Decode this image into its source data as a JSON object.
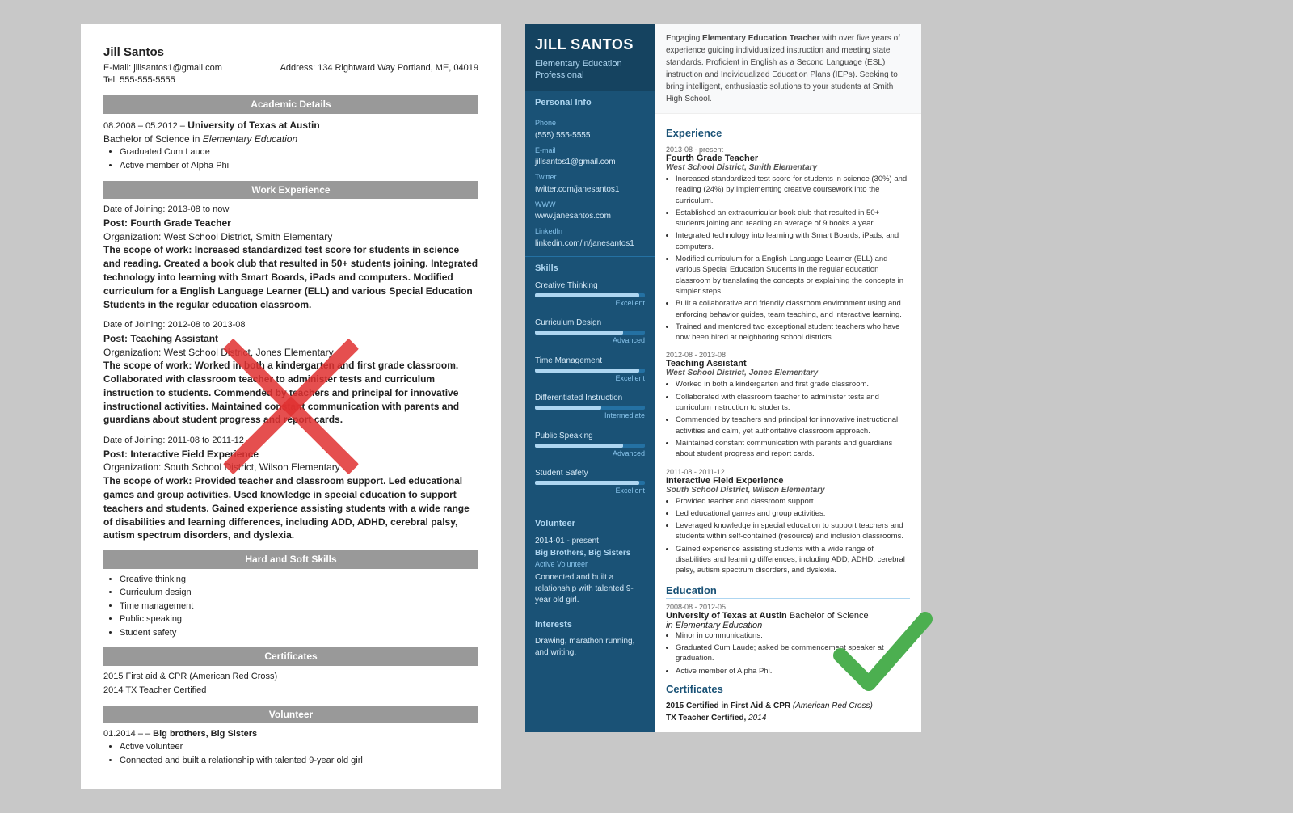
{
  "left": {
    "name": "Jill Santos",
    "email_label": "E-Mail:",
    "email": "jillsantos1@gmail.com",
    "address_label": "Address:",
    "address": "134 Rightward Way Portland, ME, 04019",
    "tel_label": "Tel:",
    "tel": "555-555-5555",
    "sections": {
      "academic": "Academic Details",
      "work": "Work Experience",
      "skills_title": "Hard and Soft Skills",
      "certs_title": "Certificates",
      "volunteer_title": "Volunteer"
    },
    "education": {
      "dates": "08.2008 – 05.2012 –",
      "school": "University of Texas at Austin",
      "degree": "Bachelor of Science in Elementary Education",
      "bullets": [
        "Graduated Cum Laude",
        "Active member of Alpha Phi"
      ]
    },
    "work": [
      {
        "dates": "Date of Joining: 2013-08 to now",
        "post_label": "Post:",
        "post": "Fourth Grade Teacher",
        "org_label": "Organization:",
        "org": "West School District, Smith Elementary",
        "scope_label": "The scope of work:",
        "scope": "Increased standardized test score for students in science and reading. Created a book club that resulted in 50+ students joining. Integrated technology into learning with Smart Boards, iPads and computers. Modified curriculum for a English Language Learner (ELL) and various Special Education Students in the regular education classroom."
      },
      {
        "dates": "Date of Joining: 2012-08 to 2013-08",
        "post_label": "Post:",
        "post": "Teaching Assistant",
        "org_label": "Organization:",
        "org": "West School District, Jones Elementary",
        "scope_label": "The scope of work:",
        "scope": "Worked in both a kindergarten and first grade classroom. Collaborated with classroom teacher to administer tests and curriculum instruction to students. Commended by teachers and principal for innovative instructional activities. Maintained constant communication with parents and guardians about student progress and report cards."
      },
      {
        "dates": "Date of Joining: 2011-08 to 2011-12",
        "post_label": "Post:",
        "post": "Interactive Field Experience",
        "org_label": "Organization:",
        "org": "South School District, Wilson Elementary",
        "scope_label": "The scope of work:",
        "scope": "Provided teacher and classroom support. Led educational games and group activities. Used knowledge in special education to support teachers and students. Gained experience assisting students with a wide range of disabilities and learning differences, including ADD, ADHD, cerebral palsy, autism spectrum disorders, and dyslexia."
      }
    ],
    "skills": [
      "Creative thinking",
      "Curriculum design",
      "Time management",
      "Public speaking",
      "Student safety"
    ],
    "certs": [
      "2015 First aid & CPR (American Red Cross)",
      "2014 TX Teacher Certified"
    ],
    "volunteer": {
      "dates": "01.2014 –",
      "org": "Big brothers, Big Sisters",
      "bullets": [
        "Active volunteer",
        "Connected and built a relationship with talented 9-year old girl"
      ]
    }
  },
  "right": {
    "name": "JILL SANTOS",
    "title": "Elementary Education Professional",
    "summary": "Engaging Elementary Education Teacher with over five years of experience guiding individualized instruction and meeting state standards. Proficient in English as a Second Language (ESL) instruction and Individualized Education Plans (IEPs). Seeking to bring intelligent, enthusiastic solutions to your students at Smith High School.",
    "sidebar": {
      "personal_info_title": "Personal Info",
      "phone_label": "Phone",
      "phone": "(555) 555-5555",
      "email_label": "E-mail",
      "email": "jillsantos1@gmail.com",
      "twitter_label": "Twitter",
      "twitter": "twitter.com/janesantos1",
      "www_label": "WWW",
      "www": "www.janesantos.com",
      "linkedin_label": "LinkedIn",
      "linkedin": "linkedin.com/in/janesantos1",
      "skills_title": "Skills",
      "skills": [
        {
          "name": "Creative Thinking",
          "level": "Excellent",
          "pct": 95
        },
        {
          "name": "Curriculum Design",
          "level": "Advanced",
          "pct": 80
        },
        {
          "name": "Time Management",
          "level": "Excellent",
          "pct": 95
        },
        {
          "name": "Differentiated Instruction",
          "level": "Intermediate",
          "pct": 60
        },
        {
          "name": "Public Speaking",
          "level": "Advanced",
          "pct": 80
        },
        {
          "name": "Student Safety",
          "level": "Excellent",
          "pct": 95
        }
      ],
      "volunteer_title": "Volunteer",
      "volunteer_dates": "2014-01 - present",
      "volunteer_org": "Big Brothers, Big Sisters",
      "volunteer_role": "Active Volunteer",
      "volunteer_desc": "Connected and built a relationship with talented 9-year old girl.",
      "interests_title": "Interests",
      "interests": "Drawing, marathon running, and writing."
    },
    "experience_title": "Experience",
    "experience": [
      {
        "dates": "2013-08 - present",
        "title": "Fourth Grade Teacher",
        "org_bold": "West School District",
        "org_rest": ", Smith Elementary",
        "bullets": [
          "Increased standardized test score for students in science (30%) and reading (24%) by implementing creative coursework into the curriculum.",
          "Established an extracurricular book club that resulted in 50+ students joining and reading an average of 9 books a year.",
          "Integrated technology into learning with Smart Boards, iPads, and computers.",
          "Modified curriculum for a English Language Learner (ELL) and various Special Education Students in the regular education classroom by translating the concepts or explaining the concepts in simpler steps.",
          "Built a collaborative and friendly classroom environment using and enforcing behavior guides, team teaching, and interactive learning.",
          "Trained and mentored two exceptional student teachers who have now been hired at neighboring school districts."
        ]
      },
      {
        "dates": "2012-08 - 2013-08",
        "title": "Teaching Assistant",
        "org_bold": "West School District",
        "org_rest": ", Jones Elementary",
        "bullets": [
          "Worked in both a kindergarten and first grade classroom.",
          "Collaborated with classroom teacher to administer tests and curriculum instruction to students.",
          "Commended by teachers and principal for innovative instructional activities and calm, yet authoritative classroom approach.",
          "Maintained constant communication with parents and guardians about student progress and report cards."
        ]
      },
      {
        "dates": "2011-08 - 2011-12",
        "title": "Interactive Field Experience",
        "org_bold": "South School District",
        "org_rest": ", Wilson Elementary",
        "bullets": [
          "Provided teacher and classroom support.",
          "Led educational games and group activities.",
          "Leveraged knowledge in special education to support teachers and students within self-contained (resource) and inclusion classrooms.",
          "Gained experience assisting students with a wide range of disabilities and learning differences, including ADD, ADHD, cerebral palsy, autism spectrum disorders, and dyslexia."
        ]
      }
    ],
    "education_title": "Education",
    "education": [
      {
        "dates": "2008-08 - 2012-05",
        "uni": "University of Texas at Austin",
        "degree": "Bachelor of Science",
        "field": "in Elementary Education",
        "bullets": [
          "Minor in communications.",
          "Graduated Cum Laude; asked be commencement speaker at graduation.",
          "Active member of Alpha Phi."
        ]
      }
    ],
    "certs_title": "Certificates",
    "certs": [
      {
        "year": "2015",
        "text": "Certified in First Aid & CPR",
        "italic": "(American Red Cross)"
      },
      {
        "year": "",
        "text": "TX Teacher Certified,",
        "italic": "2014"
      }
    ]
  }
}
